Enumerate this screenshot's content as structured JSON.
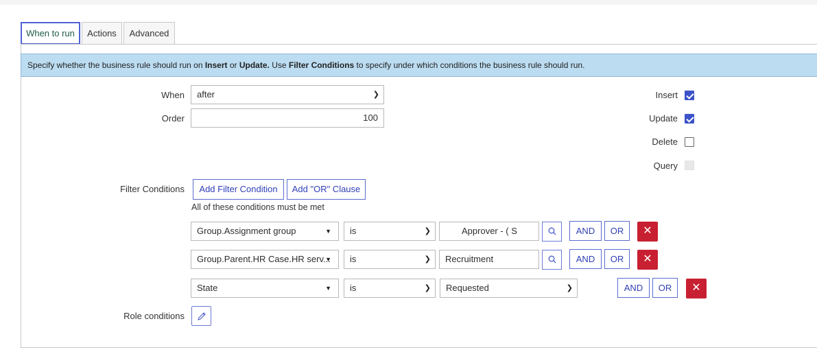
{
  "tabs": [
    {
      "label": "When to run",
      "active": true
    },
    {
      "label": "Actions",
      "active": false
    },
    {
      "label": "Advanced",
      "active": false
    }
  ],
  "info": {
    "t1": "Specify whether the business rule should run on ",
    "b1": "Insert",
    "t2": " or ",
    "b2": "Update.",
    "t3": " Use ",
    "b3": "Filter Conditions",
    "t4": " to specify under which conditions the business rule should run."
  },
  "form": {
    "when_label": "When",
    "when_value": "after",
    "order_label": "Order",
    "order_value": "100",
    "filter_label": "Filter Conditions",
    "role_label": "Role conditions"
  },
  "checkboxes": [
    {
      "label": "Insert",
      "checked": true,
      "disabled": false
    },
    {
      "label": "Update",
      "checked": true,
      "disabled": false
    },
    {
      "label": "Delete",
      "checked": false,
      "disabled": false
    },
    {
      "label": "Query",
      "checked": false,
      "disabled": true
    }
  ],
  "filter": {
    "add_condition": "Add Filter Condition",
    "add_or": "Add \"OR\" Clause",
    "all_met": "All of these conditions must be met",
    "rows": [
      {
        "field": "Group.Assignment group",
        "operator": "is",
        "value": "Approver - (  S"
      },
      {
        "field": "Group.Parent.HR Case.HR serv...",
        "operator": "is",
        "value": "Recruitment"
      },
      {
        "field": "State",
        "operator": "is",
        "value": "Requested"
      }
    ],
    "and_label": "AND",
    "or_label": "OR",
    "remove_glyph": "✕"
  },
  "colors": {
    "accent": "#3c53c9",
    "danger": "#c82032",
    "info_bg": "#bcdcf1"
  }
}
